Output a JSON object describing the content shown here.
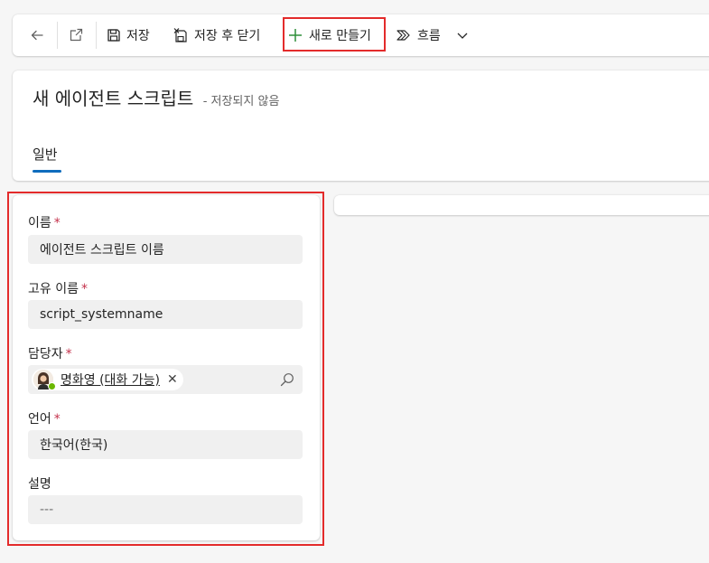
{
  "toolbar": {
    "back_icon": "arrow-left-icon",
    "popout_icon": "open-in-new-window-icon",
    "save_label": "저장",
    "save_close_label": "저장 후 닫기",
    "new_label": "새로 만들기",
    "flow_label": "흐름",
    "highlight_color": "#e32b2b"
  },
  "header": {
    "title": "새 에이전트 스크립트",
    "subtitle": "- 저장되지 않음",
    "tabs": [
      {
        "label": "일반",
        "selected": true
      }
    ],
    "accent_color": "#0f6cbd"
  },
  "form": {
    "fields": [
      {
        "label": "이름",
        "required": "*",
        "value": "에이전트 스크립트 이름"
      },
      {
        "label": "고유 이름",
        "required": "*",
        "value": "script_systemname"
      },
      {
        "label": "담당자",
        "required": "*",
        "owner_name": "명화영 (대화 가능)",
        "remove_glyph": "✕"
      },
      {
        "label": "언어",
        "required": "*",
        "value": "한국어(한국)"
      },
      {
        "label": "설명",
        "required": "",
        "value": "---"
      }
    ]
  }
}
